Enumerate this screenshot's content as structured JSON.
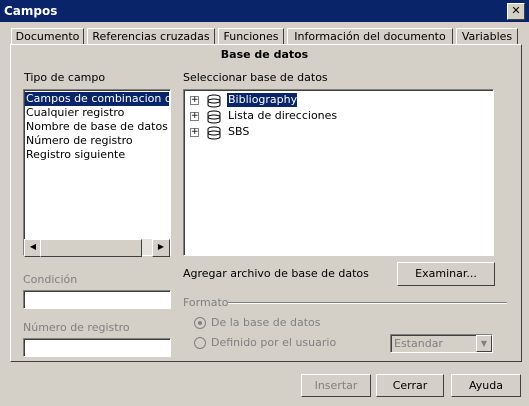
{
  "window": {
    "title": "Campos",
    "close_glyph": "✕"
  },
  "tabs": [
    {
      "label": "Documento"
    },
    {
      "label": "Referencias cruzadas"
    },
    {
      "label": "Funciones"
    },
    {
      "label": "Información del documento"
    },
    {
      "label": "Variables"
    },
    {
      "label": "Base de datos"
    }
  ],
  "panel_heading": "Base de datos",
  "field_type": {
    "label": "Tipo de campo",
    "items": [
      "Campos de combinacion de co",
      "Cualquier registro",
      "Nombre de base de datos",
      "Número de registro",
      "Registro siguiente"
    ],
    "selected_index": 0
  },
  "database_select": {
    "label": "Seleccionar base de datos",
    "items": [
      "Bibliography",
      "Lista de direcciones",
      "SBS"
    ],
    "selected_index": 0
  },
  "condition": {
    "label": "Condición",
    "value": ""
  },
  "record_number": {
    "label": "Número de registro",
    "value": ""
  },
  "add_db": {
    "label": "Agregar archivo de base de datos",
    "button": "Examinar..."
  },
  "format": {
    "label": "Formato",
    "option_db": "De la base de datos",
    "option_user": "Definido por el usuario",
    "select_value": "Estandar"
  },
  "buttons": {
    "insert": "Insertar",
    "close": "Cerrar",
    "help": "Ayuda"
  }
}
